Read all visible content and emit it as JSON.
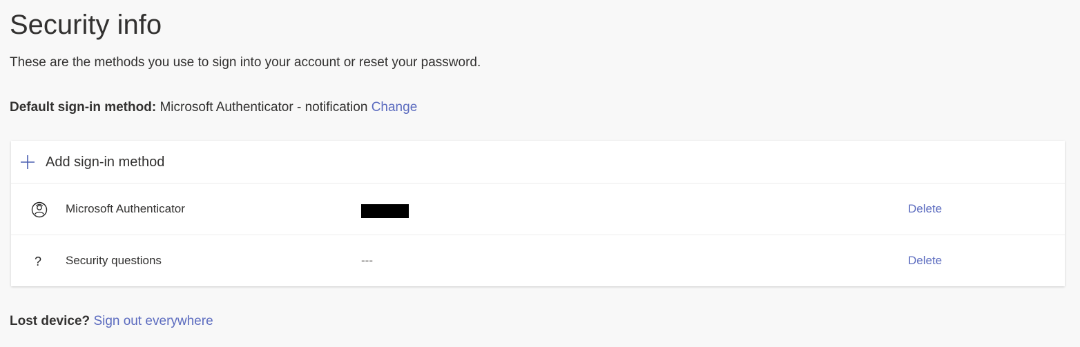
{
  "page": {
    "title": "Security info",
    "subtitle": "These are the methods you use to sign into your account or reset your password."
  },
  "default_method": {
    "label": "Default sign-in method:",
    "value": "Microsoft Authenticator - notification",
    "change_label": "Change"
  },
  "card": {
    "add_label": "Add sign-in method",
    "add_icon": "plus-icon",
    "methods": [
      {
        "icon": "authenticator-icon",
        "name": "Microsoft Authenticator",
        "detail": "",
        "detail_redacted": true,
        "action": "Delete"
      },
      {
        "icon": "question-icon",
        "icon_glyph": "?",
        "name": "Security questions",
        "detail": "---",
        "action": "Delete"
      }
    ]
  },
  "lost_device": {
    "label": "Lost device?",
    "link": "Sign out everywhere"
  },
  "colors": {
    "background": "#f8f8f8",
    "card": "#ffffff",
    "link": "#5b6bbf",
    "accent_plus": "#4a5eb0"
  }
}
